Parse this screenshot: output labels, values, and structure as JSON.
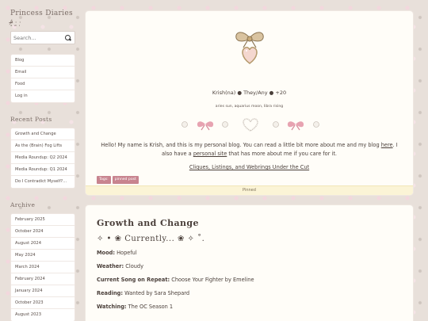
{
  "sidebar": {
    "title": "Princess Diaries",
    "subtitle": "ᵒ̴̶̷̥́ ·̫ ·̩",
    "search_placeholder": "Search...",
    "menu": [
      "Blog",
      "Email",
      "Food",
      "Log in"
    ],
    "recent_heading": "Recent Posts",
    "recent_posts": [
      "Growth and Change",
      "As the (Brain) Fog Lifts",
      "Media Roundup: Q2 2024",
      "Media Roundup: Q1 2024",
      "Do I Contradict Myself?..."
    ],
    "archive_heading": "Archive",
    "archive": [
      "February 2025",
      "October 2024",
      "August 2024",
      "May 2024",
      "March 2024",
      "February 2024",
      "January 2024",
      "October 2023",
      "August 2023"
    ]
  },
  "pinned_post": {
    "author_line": "Krish(na) ● They/Any ● +20",
    "signs_line": "aries sun, aquarius moon, libra rising",
    "intro_before_here": "Hello! My name is Krish, and this is my personal blog. You can read a little bit more about me and my blog ",
    "intro_here": "here",
    "intro_after_here": ". I also have a ",
    "intro_site": "personal site",
    "intro_end": " that has more about me if you care for it.",
    "cliques_link": "Cliques, Listings, and Webrings Under the Cut",
    "tags_label": "Tags:",
    "tags": [
      "pinned post"
    ],
    "pinned_label": "Pinned"
  },
  "post": {
    "title": "Growth and Change",
    "currently_heading": "✧ • ❀ Currently... ❀ ✧ ˚.",
    "fields": [
      {
        "label": "Mood:",
        "value": " Hopeful"
      },
      {
        "label": "Weather:",
        "value": " Cloudy"
      },
      {
        "label": "Current Song on Repeat:",
        "value": " Choose Your Fighter by Emeline"
      },
      {
        "label": "Reading:",
        "value": " Wanted by Sara Shepard"
      },
      {
        "label": "Watching:",
        "value": " The OC Season 1"
      }
    ]
  },
  "colors": {
    "accent_pink": "#c8848f",
    "pinned_bar": "#fbf4d6",
    "card_bg": "#fffdf8"
  }
}
